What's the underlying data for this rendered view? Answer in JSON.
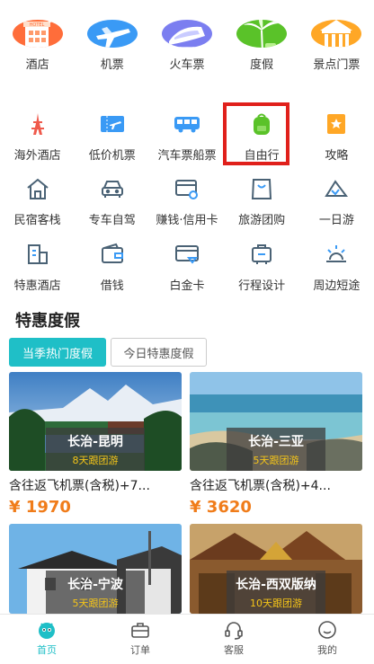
{
  "top_icons": [
    {
      "label": "酒店",
      "icon": "hotel-icon",
      "color": "#ff6d3a"
    },
    {
      "label": "机票",
      "icon": "airplane-icon",
      "color": "#3a9af5"
    },
    {
      "label": "火车票",
      "icon": "train-icon",
      "color": "#7b7ef0"
    },
    {
      "label": "度假",
      "icon": "palm-tree-icon",
      "color": "#5ac229"
    },
    {
      "label": "景点门票",
      "icon": "temple-icon",
      "color": "#ffa726"
    }
  ],
  "row2": [
    {
      "label": "海外酒店",
      "icon": "eiffel-tower-icon"
    },
    {
      "label": "低价机票",
      "icon": "ticket-plane-icon"
    },
    {
      "label": "汽车票船票",
      "icon": "bus-icon"
    },
    {
      "label": "自由行",
      "icon": "backpack-icon"
    },
    {
      "label": "攻略",
      "icon": "guide-star-icon"
    }
  ],
  "row3": [
    {
      "label": "民宿客栈",
      "icon": "homestay-icon"
    },
    {
      "label": "专车自驾",
      "icon": "car-icon"
    },
    {
      "label": "赚钱·信用卡",
      "icon": "credit-card-icon"
    },
    {
      "label": "旅游团购",
      "icon": "shopping-bag-icon"
    },
    {
      "label": "一日游",
      "icon": "mountain-icon"
    }
  ],
  "row4": [
    {
      "label": "特惠酒店",
      "icon": "building-icon"
    },
    {
      "label": "借钱",
      "icon": "wallet-icon"
    },
    {
      "label": "白金卡",
      "icon": "platinum-card-icon"
    },
    {
      "label": "行程设计",
      "icon": "itinerary-icon"
    },
    {
      "label": "周边短途",
      "icon": "sunrise-icon"
    }
  ],
  "section": {
    "title": "特惠度假"
  },
  "tabs": {
    "active": "当季热门度假",
    "inactive": "今日特惠度假"
  },
  "cards": [
    {
      "route": "长治-昆明",
      "sub": "8天跟团游",
      "title": "含往返飞机票(含税)+7...",
      "price": "¥ 1970"
    },
    {
      "route": "长治-三亚",
      "sub": "5天跟团游",
      "title": "含往返飞机票(含税)+4...",
      "price": "¥ 3620"
    },
    {
      "route": "长治-宁波",
      "sub": "5天跟团游",
      "title": "",
      "price": ""
    },
    {
      "route": "长治-西双版纳",
      "sub": "10天跟团游",
      "title": "",
      "price": ""
    }
  ],
  "nav": [
    {
      "label": "首页",
      "icon": "home-face-icon",
      "active": true
    },
    {
      "label": "订单",
      "icon": "briefcase-icon"
    },
    {
      "label": "客服",
      "icon": "headset-icon"
    },
    {
      "label": "我的",
      "icon": "profile-icon"
    }
  ],
  "colors": {
    "accent": "#1fbfc7",
    "price": "#f07c1a",
    "highlight": "#e0201b",
    "tag": "#f5c518"
  }
}
